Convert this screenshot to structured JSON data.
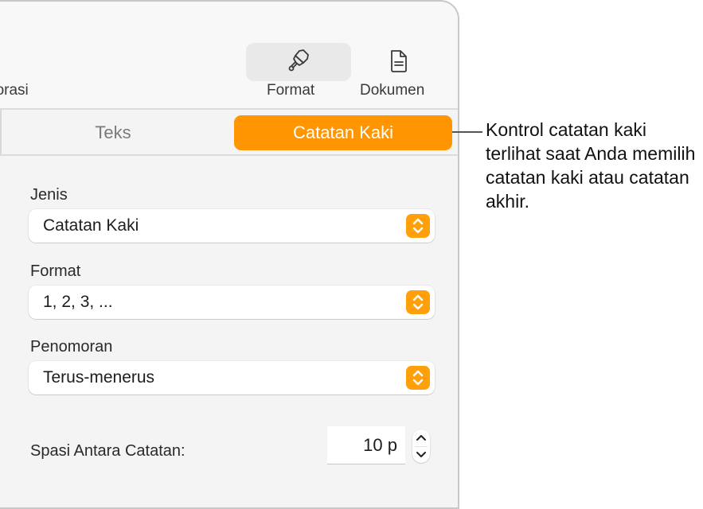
{
  "toolbar": {
    "left_partial_label": "porasi",
    "format_label": "Format",
    "format_icon": "paintbrush-icon",
    "document_label": "Dokumen",
    "document_icon": "document-icon"
  },
  "tabs": [
    {
      "label": "Teks",
      "selected": false
    },
    {
      "label": "Catatan Kaki",
      "selected": true
    }
  ],
  "accent_color": "#ff9500",
  "fields": {
    "type": {
      "label": "Jenis",
      "value": "Catatan Kaki"
    },
    "format": {
      "label": "Format",
      "value": "1, 2, 3, ..."
    },
    "numbering": {
      "label": "Penomoran",
      "value": "Terus-menerus"
    },
    "spacing": {
      "label": "Spasi Antara Catatan:",
      "value": "10 p"
    }
  },
  "callout": {
    "text": "Kontrol catatan kaki terlihat saat Anda memilih catatan kaki atau catatan akhir."
  }
}
